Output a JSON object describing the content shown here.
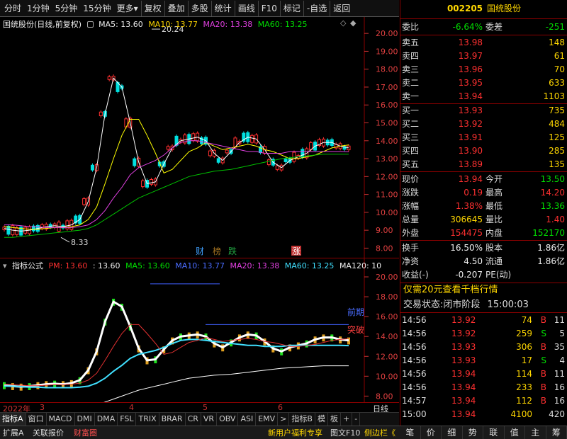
{
  "toolbar": {
    "items": [
      "分时",
      "1分钟",
      "5分钟",
      "15分钟",
      "更多",
      "复权",
      "叠加",
      "多股",
      "统计",
      "画线",
      "F10",
      "标记",
      "-自选",
      "返回"
    ]
  },
  "main_legend": {
    "title": "国统股份(日线,前复权)",
    "ma5": "MA5: 13.60",
    "ma10": "MA10: 13.77",
    "ma20": "MA20: 13.38",
    "ma60": "MA60: 13.25"
  },
  "main_axis": {
    "ticks": [
      "20.00",
      "19.00",
      "18.00",
      "17.00",
      "16.00",
      "15.00",
      "14.00",
      "13.00",
      "12.00",
      "11.00",
      "10.00",
      "9.00",
      "8.00"
    ],
    "high_label": "20.24",
    "low_label": "8.33"
  },
  "markers": [
    "财",
    "榜",
    "跌",
    "涨"
  ],
  "ind_legend": {
    "title": "指标公式",
    "pm": "PM: 13.60",
    "v2": ": 13.60",
    "ma5": "MA5: 13.60",
    "ma10": "MA10: 13.77",
    "ma20": "MA20: 13.38",
    "ma60": "MA60: 13.25",
    "ma120": "MA120: 10"
  },
  "ind_axis": {
    "ticks": [
      "20.00",
      "18.00",
      "16.00",
      "14.00",
      "12.00",
      "10.00",
      "8.00"
    ]
  },
  "ind_labels": {
    "qianqi": "前期",
    "tupo": "突破"
  },
  "time_axis": {
    "labels": [
      "2022年",
      "3",
      "4",
      "5",
      "6"
    ],
    "right": "日线"
  },
  "tabs": [
    "指标A",
    "窗口",
    "MACD",
    "DMI",
    "DMA",
    "FSL",
    "TRIX",
    "BRAR",
    "CR",
    "VR",
    "OBV",
    "ASI",
    "EMV",
    ">",
    "指标B",
    "模",
    "板",
    "+",
    "-"
  ],
  "bottombar": {
    "left": [
      "扩展A",
      "关联报价",
      "财富圈"
    ],
    "promo": "新用户福利专享",
    "f10": "图文F10",
    "side": "侧边栏《"
  },
  "stock": {
    "code": "002205",
    "name": "国统股份"
  },
  "weibi": {
    "label": "委比",
    "value": "-6.64%",
    "label2": "委差",
    "value2": "-251"
  },
  "asks": [
    {
      "label": "卖五",
      "price": "13.98",
      "vol": "148"
    },
    {
      "label": "卖四",
      "price": "13.97",
      "vol": "61"
    },
    {
      "label": "卖三",
      "price": "13.96",
      "vol": "70"
    },
    {
      "label": "卖二",
      "price": "13.95",
      "vol": "633"
    },
    {
      "label": "卖一",
      "price": "13.94",
      "vol": "1103"
    }
  ],
  "bids": [
    {
      "label": "买一",
      "price": "13.93",
      "vol": "735"
    },
    {
      "label": "买二",
      "price": "13.92",
      "vol": "484"
    },
    {
      "label": "买三",
      "price": "13.91",
      "vol": "125"
    },
    {
      "label": "买四",
      "price": "13.90",
      "vol": "285"
    },
    {
      "label": "买五",
      "price": "13.89",
      "vol": "135"
    }
  ],
  "quote": [
    {
      "l1": "现价",
      "v1": "13.94",
      "l2": "今开",
      "v2": "13.50",
      "c1": "red",
      "c2": "green"
    },
    {
      "l1": "涨跌",
      "v1": "0.19",
      "l2": "最高",
      "v2": "14.20",
      "c1": "red",
      "c2": "red"
    },
    {
      "l1": "涨幅",
      "v1": "1.38%",
      "l2": "最低",
      "v2": "13.36",
      "c1": "red",
      "c2": "green"
    },
    {
      "l1": "总量",
      "v1": "306645",
      "l2": "量比",
      "v2": "1.40",
      "c1": "yellow",
      "c2": "red"
    },
    {
      "l1": "外盘",
      "v1": "154475",
      "l2": "内盘",
      "v2": "152170",
      "c1": "red",
      "c2": "green"
    }
  ],
  "stats": [
    {
      "l1": "换手",
      "v1": "16.50%",
      "l2": "股本",
      "v2": "1.86亿"
    },
    {
      "l1": "净资",
      "v1": "4.50",
      "l2": "流通",
      "v2": "1.86亿"
    },
    {
      "l1": "收益(-)",
      "v1": "-0.207",
      "l2": "PE(动)",
      "v2": ""
    }
  ],
  "promo": "仅需20元查看千档行情",
  "trade_state": {
    "label": "交易状态:",
    "value": "闭市阶段",
    "time": "15:00:03"
  },
  "ticks": [
    {
      "time": "14:56",
      "price": "13.92",
      "vol": "74",
      "bs": "B",
      "n": "11"
    },
    {
      "time": "14:56",
      "price": "13.92",
      "vol": "259",
      "bs": "S",
      "n": "5"
    },
    {
      "time": "14:56",
      "price": "13.93",
      "vol": "306",
      "bs": "B",
      "n": "35"
    },
    {
      "time": "14:56",
      "price": "13.93",
      "vol": "17",
      "bs": "S",
      "n": "4"
    },
    {
      "time": "14:56",
      "price": "13.94",
      "vol": "114",
      "bs": "B",
      "n": "11"
    },
    {
      "time": "14:56",
      "price": "13.94",
      "vol": "233",
      "bs": "B",
      "n": "16"
    },
    {
      "time": "14:57",
      "price": "13.94",
      "vol": "112",
      "bs": "B",
      "n": "16"
    },
    {
      "time": "15:00",
      "price": "13.94",
      "vol": "4100",
      "bs": "",
      "n": "420"
    }
  ],
  "side_tabs": [
    "笔",
    "价",
    "细",
    "势",
    "联",
    "值",
    "主",
    "筹"
  ],
  "colors": {
    "up": "#ff3030",
    "down": "#00e0e0",
    "ma5": "#ffffff",
    "ma10": "#ffff00",
    "ma20": "#e040e0",
    "ma60": "#00c000"
  },
  "chart_data": {
    "type": "candlestick",
    "ylim": [
      7.7,
      20.6
    ],
    "series": [
      {
        "name": "MA5",
        "values": [
          9.1,
          9.0,
          8.95,
          9.0,
          9.1,
          9.2,
          9.25,
          9.2,
          9.3,
          9.6,
          10.6,
          12.5,
          15.5,
          17.5,
          17.0,
          15.0,
          12.8,
          11.6,
          11.7,
          12.7,
          13.6,
          14.0,
          14.1,
          14.2,
          14.0,
          13.3,
          12.9,
          13.4,
          13.9,
          14.2,
          14.1,
          13.5,
          12.8,
          12.5,
          12.9,
          13.1,
          13.3,
          13.7,
          13.9,
          13.9,
          13.7,
          13.6
        ]
      },
      {
        "name": "MA10",
        "values": [
          9.2,
          9.15,
          9.1,
          9.05,
          9.05,
          9.1,
          9.15,
          9.15,
          9.2,
          9.3,
          9.6,
          10.3,
          11.6,
          13.0,
          14.3,
          15.2,
          15.2,
          14.3,
          13.3,
          12.2,
          12.4,
          12.9,
          13.4,
          13.6,
          13.9,
          13.7,
          13.5,
          13.6,
          13.7,
          13.8,
          13.7,
          13.5,
          13.4,
          13.2,
          13.0,
          13.0,
          13.1,
          13.2,
          13.4,
          13.6,
          13.7,
          13.77
        ]
      },
      {
        "name": "MA20",
        "values": [
          9.3,
          9.3,
          9.25,
          9.2,
          9.2,
          9.15,
          9.15,
          9.15,
          9.15,
          9.2,
          9.3,
          9.6,
          10.1,
          10.8,
          11.4,
          12.1,
          12.5,
          12.7,
          12.9,
          13.2,
          13.6,
          13.9,
          14.0,
          14.0,
          13.9,
          13.8,
          13.7,
          13.6,
          13.5,
          13.4,
          13.4,
          13.3,
          13.3,
          13.3,
          13.4,
          13.4,
          13.4,
          13.4,
          13.4,
          13.4,
          13.4,
          13.38
        ]
      },
      {
        "name": "MA60",
        "values": [
          8.6,
          8.6,
          8.65,
          8.7,
          8.75,
          8.8,
          8.85,
          8.9,
          8.95,
          9.0,
          9.1,
          9.3,
          9.6,
          9.9,
          10.2,
          10.5,
          10.8,
          11.0,
          11.2,
          11.4,
          11.6,
          11.8,
          12.0,
          12.1,
          12.2,
          12.3,
          12.35,
          12.4,
          12.5,
          12.6,
          12.7,
          12.8,
          12.9,
          13.0,
          13.05,
          13.1,
          13.15,
          13.2,
          13.25,
          13.25,
          13.25,
          13.25
        ]
      }
    ]
  }
}
